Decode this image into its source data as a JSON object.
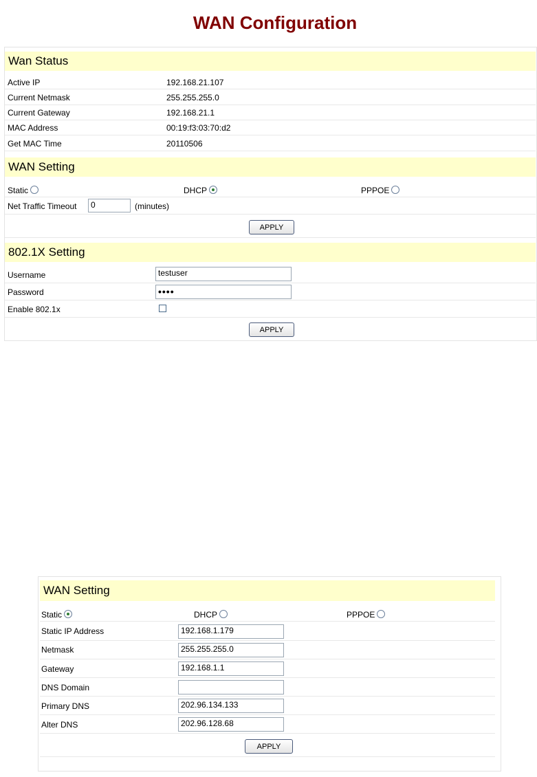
{
  "page_title": "WAN Configuration",
  "wan_status": {
    "header": "Wan Status",
    "rows": [
      {
        "label": "Active IP",
        "value": "192.168.21.107"
      },
      {
        "label": "Current Netmask",
        "value": "255.255.255.0"
      },
      {
        "label": "Current Gateway",
        "value": "192.168.21.1"
      },
      {
        "label": "MAC Address",
        "value": "00:19:f3:03:70:d2"
      },
      {
        "label": "Get MAC Time",
        "value": "20110506"
      }
    ]
  },
  "wan_setting": {
    "header": "WAN Setting",
    "static_label": "Static",
    "dhcp_label": "DHCP",
    "pppoe_label": "PPPOE",
    "selected": "DHCP",
    "timeout_label": "Net Traffic Timeout",
    "timeout_value": "0",
    "timeout_unit": "(minutes)",
    "apply_label": "APPLY"
  },
  "dot1x": {
    "header": "802.1X Setting",
    "username_label": "Username",
    "username_value": "testuser",
    "password_label": "Password",
    "password_mask": "••••",
    "enable_label": "Enable 802.1x",
    "enabled": false,
    "apply_label": "APPLY"
  },
  "wan_static": {
    "header": "WAN Setting",
    "static_label": "Static",
    "dhcp_label": "DHCP",
    "pppoe_label": "PPPOE",
    "selected": "Static",
    "fields": [
      {
        "label": "Static IP Address",
        "value": "192.168.1.179"
      },
      {
        "label": "Netmask",
        "value": "255.255.255.0"
      },
      {
        "label": "Gateway",
        "value": "192.168.1.1"
      },
      {
        "label": "DNS Domain",
        "value": ""
      },
      {
        "label": "Primary DNS",
        "value": "202.96.134.133"
      },
      {
        "label": "Alter DNS",
        "value": "202.96.128.68"
      }
    ],
    "apply_label": "APPLY"
  },
  "colors": {
    "title": "#800000",
    "header_bg": "#ffffcc",
    "radio_dot": "#2e7d32"
  }
}
